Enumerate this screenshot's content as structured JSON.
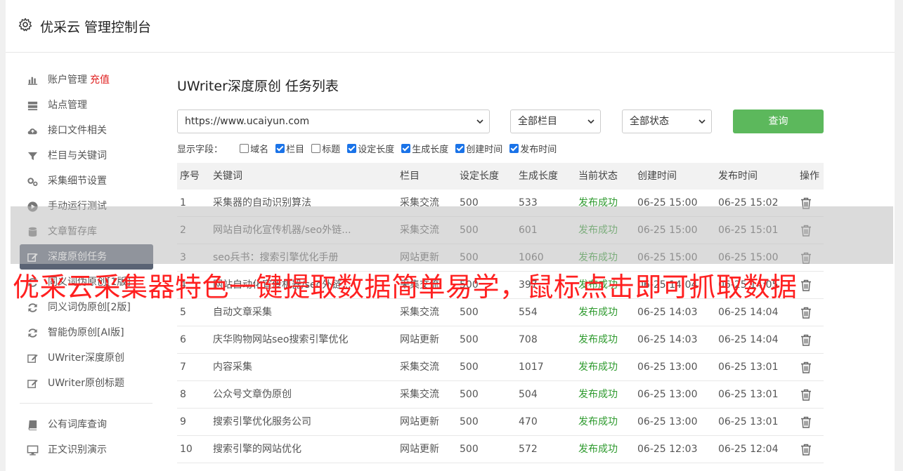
{
  "header": {
    "title": "优采云 管理控制台",
    "icon": "gear-icon"
  },
  "sidebar": {
    "items": [
      {
        "label": "账户管理",
        "badge": "充值",
        "icon": "bar-chart-icon"
      },
      {
        "label": "站点管理",
        "icon": "server-icon"
      },
      {
        "label": "接口文件相关",
        "icon": "cloud-upload-icon"
      },
      {
        "label": "栏目与关键词",
        "icon": "filter-icon"
      },
      {
        "label": "采集细节设置",
        "icon": "gears-icon"
      },
      {
        "label": "手动运行测试",
        "icon": "play-circle-icon"
      },
      {
        "label": "文章暂存库",
        "icon": "database-icon"
      },
      {
        "label": "深度原创任务",
        "icon": "edit-icon",
        "active": true
      },
      {
        "label": "同义词伪原创[1版]",
        "icon": "refresh-icon"
      },
      {
        "label": "同义词伪原创[2版]",
        "icon": "refresh-icon"
      },
      {
        "label": "智能伪原创[AI版]",
        "icon": "refresh-icon"
      },
      {
        "label": "UWriter深度原创",
        "icon": "edit-icon"
      },
      {
        "label": "UWriter原创标题",
        "icon": "edit-icon"
      }
    ],
    "items2": [
      {
        "label": "公有词库查询",
        "icon": "book-icon"
      },
      {
        "label": "正文识别演示",
        "icon": "monitor-icon"
      }
    ]
  },
  "main": {
    "title": "UWriter深度原创 任务列表",
    "site_select": "https://www.ucaiyun.com",
    "column_select": "全部栏目",
    "status_select": "全部状态",
    "query_label": "查询",
    "fields_label": "显示字段：",
    "fields": [
      {
        "label": "域名",
        "checked": false
      },
      {
        "label": "栏目",
        "checked": true
      },
      {
        "label": "标题",
        "checked": false
      },
      {
        "label": "设定长度",
        "checked": true
      },
      {
        "label": "生成长度",
        "checked": true
      },
      {
        "label": "创建时间",
        "checked": true
      },
      {
        "label": "发布时间",
        "checked": true
      }
    ],
    "columns": [
      "序号",
      "关键词",
      "栏目",
      "设定长度",
      "生成长度",
      "当前状态",
      "创建时间",
      "发布时间",
      "操作"
    ],
    "rows": [
      [
        "1",
        "采集器的自动识别算法",
        "采集交流",
        "500",
        "533",
        "发布成功",
        "06-25 15:00",
        "06-25 15:02"
      ],
      [
        "2",
        "网站自动化宣传机器/seo外链...",
        "采集交流",
        "500",
        "601",
        "发布成功",
        "06-25 15:00",
        "06-25 15:01"
      ],
      [
        "3",
        "seo兵书：搜索引擎优化手册",
        "网站更新",
        "500",
        "1060",
        "发布成功",
        "06-25 15:00",
        "06-25 15:00"
      ],
      [
        "4",
        "网站自动化宣传机器/seo外链...",
        "采集交流",
        "500",
        "397",
        "发布成功",
        "06-25 14:04",
        "06-25 14:05"
      ],
      [
        "5",
        "自动文章采集",
        "采集交流",
        "500",
        "554",
        "发布成功",
        "06-25 14:03",
        "06-25 14:04"
      ],
      [
        "6",
        "庆华购物网站seo搜索引擎优化",
        "网站更新",
        "500",
        "708",
        "发布成功",
        "06-25 14:03",
        "06-25 14:04"
      ],
      [
        "7",
        "内容采集",
        "采集交流",
        "500",
        "1017",
        "发布成功",
        "06-25 13:00",
        "06-25 13:01"
      ],
      [
        "8",
        "公众号文章伪原创",
        "采集交流",
        "500",
        "504",
        "发布成功",
        "06-25 13:00",
        "06-25 13:01"
      ],
      [
        "9",
        "搜索引擎优化服务公司",
        "网站更新",
        "500",
        "470",
        "发布成功",
        "06-25 13:00",
        "06-25 13:01"
      ],
      [
        "10",
        "搜索引擎的网站优化",
        "网站更新",
        "500",
        "572",
        "发布成功",
        "06-25 12:03",
        "06-25 12:04"
      ]
    ]
  },
  "overlay": {
    "banner": "优采云采集器特色一键提取数据简单易学，鼠标点击即可抓取数据"
  },
  "colors": {
    "accent_green": "#5cb85c",
    "status_ok": "#2e9a2e",
    "active_nav": "#5a6374",
    "banner_red": "#ff2020"
  }
}
